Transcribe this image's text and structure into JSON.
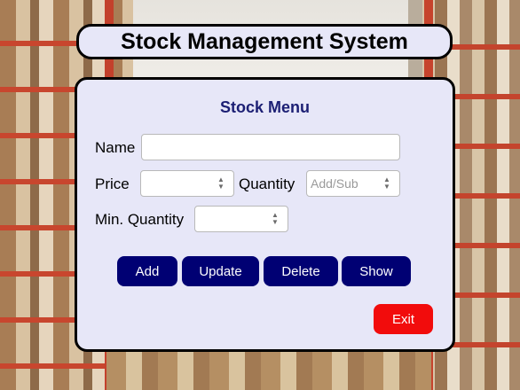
{
  "app": {
    "title": "Stock Management System"
  },
  "menu": {
    "title": "Stock Menu"
  },
  "form": {
    "name_label": "Name",
    "name_value": "",
    "price_label": "Price",
    "price_value": "",
    "quantity_label": "Quantity",
    "quantity_placeholder": "Add/Sub",
    "min_quantity_label": "Min. Quantity",
    "min_quantity_value": ""
  },
  "actions": {
    "add": "Add",
    "update": "Update",
    "delete": "Delete",
    "show": "Show",
    "exit": "Exit"
  },
  "colors": {
    "primary_button": "#000073",
    "exit_button": "#f20c0c",
    "panel_bg": "#e7e7f8",
    "menu_title": "#1c1f74"
  },
  "icons": [
    "spinner-arrows-icon"
  ]
}
